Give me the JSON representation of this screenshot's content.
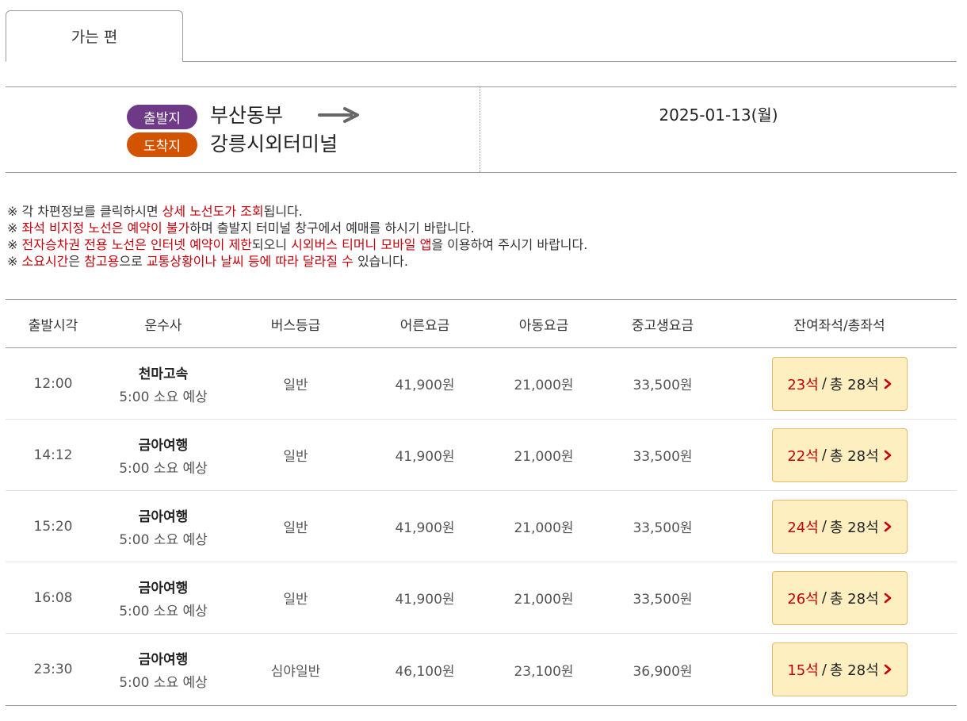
{
  "tab": {
    "label": "가는 편"
  },
  "route": {
    "departure_badge": "출발지",
    "arrival_badge": "도착지",
    "departure": "부산동부",
    "arrival": "강릉시외터미널",
    "date": "2025-01-13(월)",
    "badge_colors": {
      "departure": "#6e3a87",
      "arrival": "#d35400"
    }
  },
  "notices": [
    {
      "mark": "※",
      "parts": [
        {
          "t": " 각 차편정보를 클릭하시면 ",
          "red": false
        },
        {
          "t": "상세 노선도가 조회",
          "red": true
        },
        {
          "t": "됩니다.",
          "red": false
        }
      ]
    },
    {
      "mark": "※",
      "parts": [
        {
          "t": " ",
          "red": false
        },
        {
          "t": "좌석 비지정 노선은 예약이 불가",
          "red": true
        },
        {
          "t": "하며 출발지 터미널 창구에서 예매를 하시기 바랍니다.",
          "red": false
        }
      ]
    },
    {
      "mark": "※",
      "parts": [
        {
          "t": " ",
          "red": false
        },
        {
          "t": "전자승차권 전용 노선은 인터넷 예약이 제한",
          "red": true
        },
        {
          "t": "되오니 ",
          "red": false
        },
        {
          "t": "시외버스 티머니 모바일 앱",
          "red": true
        },
        {
          "t": "을 이용하여 주시기 바랍니다.",
          "red": false
        }
      ]
    },
    {
      "mark": "※",
      "parts": [
        {
          "t": " ",
          "red": false
        },
        {
          "t": "소요시간",
          "red": true
        },
        {
          "t": "은 ",
          "red": false
        },
        {
          "t": "참고용",
          "red": true
        },
        {
          "t": "으로 ",
          "red": false
        },
        {
          "t": "교통상황이나 날씨 등에 따라 달라질 수",
          "red": true
        },
        {
          "t": " 있습니다.",
          "red": false
        }
      ]
    }
  ],
  "table": {
    "headers": [
      "출발시각",
      "운수사",
      "버스등급",
      "어른요금",
      "아동요금",
      "중고생요금",
      "잔여좌석/총좌석"
    ],
    "rows": [
      {
        "time": "12:00",
        "company": "천마고속",
        "duration": "5:00 소요 예상",
        "grade": "일반",
        "adult": "41,900원",
        "child": "21,000원",
        "student": "33,500원",
        "remaining": "23석",
        "sep": "/",
        "total": "총 28석"
      },
      {
        "time": "14:12",
        "company": "금아여행",
        "duration": "5:00 소요 예상",
        "grade": "일반",
        "adult": "41,900원",
        "child": "21,000원",
        "student": "33,500원",
        "remaining": "22석",
        "sep": "/",
        "total": "총 28석"
      },
      {
        "time": "15:20",
        "company": "금아여행",
        "duration": "5:00 소요 예상",
        "grade": "일반",
        "adult": "41,900원",
        "child": "21,000원",
        "student": "33,500원",
        "remaining": "24석",
        "sep": "/",
        "total": "총 28석"
      },
      {
        "time": "16:08",
        "company": "금아여행",
        "duration": "5:00 소요 예상",
        "grade": "일반",
        "adult": "41,900원",
        "child": "21,000원",
        "student": "33,500원",
        "remaining": "26석",
        "sep": "/",
        "total": "총 28석"
      },
      {
        "time": "23:30",
        "company": "금아여행",
        "duration": "5:00 소요 예상",
        "grade": "심야일반",
        "adult": "46,100원",
        "child": "23,100원",
        "student": "36,900원",
        "remaining": "15석",
        "sep": "/",
        "total": "총 28석"
      }
    ]
  },
  "icons": {
    "route_arrow": "arrow-right-icon",
    "seat_chevron": "chevron-right-icon"
  },
  "colors": {
    "accent_red": "#c8000a",
    "seat_button_bg": "#fdefc0",
    "seat_button_border": "#e8b86b"
  }
}
